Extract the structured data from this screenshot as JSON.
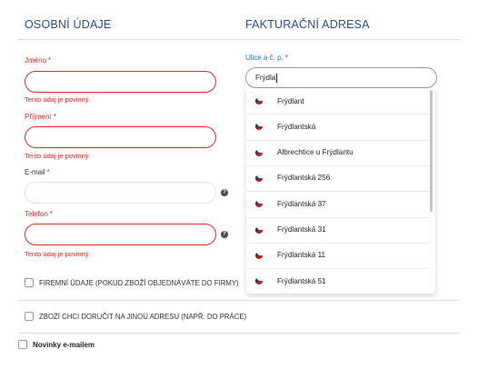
{
  "personal": {
    "heading": "OSOBNÍ ÚDAJE",
    "first_name_label": "Jméno",
    "last_name_label": "Příjmení",
    "email_label": "E-mail",
    "phone_label": "Telefon",
    "required_mark": "*",
    "error_text": "Tento údaj je povinný.",
    "help_glyph": "?"
  },
  "billing": {
    "heading": "FAKTURAČNÍ ADRESA",
    "street_label": "Ulice a č. p.",
    "street_value": "Frýdla"
  },
  "suggestions": [
    {
      "label": "Frýdlant"
    },
    {
      "label": "Frýdlantská"
    },
    {
      "label": "Albrechtice u Frýdlantu"
    },
    {
      "label": "Frýdlantská 256"
    },
    {
      "label": "Frýdlantská 37"
    },
    {
      "label": "Frýdlantská 31"
    },
    {
      "label": "Frýdlantská 11"
    },
    {
      "label": "Frýdlantská 51"
    }
  ],
  "options": {
    "company_label": "FIREMNÍ ÚDAJE (POKUD ZBOŽÍ OBJEDNÁVÁTE DO FIRMY)",
    "other_address_label": "ZBOŽÍ CHCI DORUČIT NA JINOU ADRESU (NAPŘ. DO PRÁCE)",
    "newsletter_label": "Novinky e-mailem"
  }
}
